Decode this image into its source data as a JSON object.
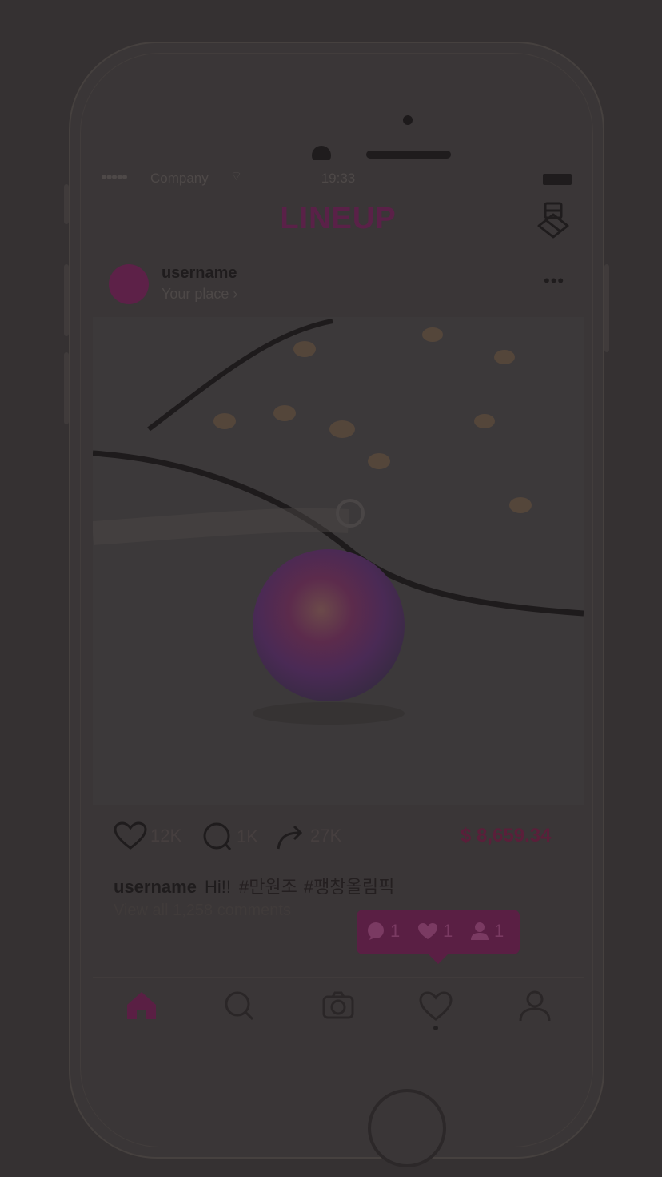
{
  "status_bar": {
    "signal": "●●●●●",
    "carrier": "Company",
    "wifi": "⌔",
    "time": "19:33"
  },
  "header": {
    "title": "LINEUP",
    "gift_icon": "gift-icon"
  },
  "post": {
    "username": "username",
    "place": "Your place ›",
    "more": "•••",
    "likes": "12K",
    "comments_count": "1K",
    "shares": "27K",
    "price": "$ 8,659.34",
    "caption_user": "username",
    "caption_text": "Hi!!",
    "hashtags": [
      "#만원조",
      "#팽창올림픽"
    ],
    "view_comments": "View all 1,258 comments"
  },
  "notification": {
    "comments": "1",
    "likes": "1",
    "followers": "1"
  },
  "tabbar": {
    "items": [
      "home-icon",
      "search-icon",
      "camera-icon",
      "heart-icon",
      "profile-icon"
    ],
    "active": "home-icon"
  },
  "colors": {
    "accent": "#5a1f44",
    "overlay_bg": "#353132"
  }
}
